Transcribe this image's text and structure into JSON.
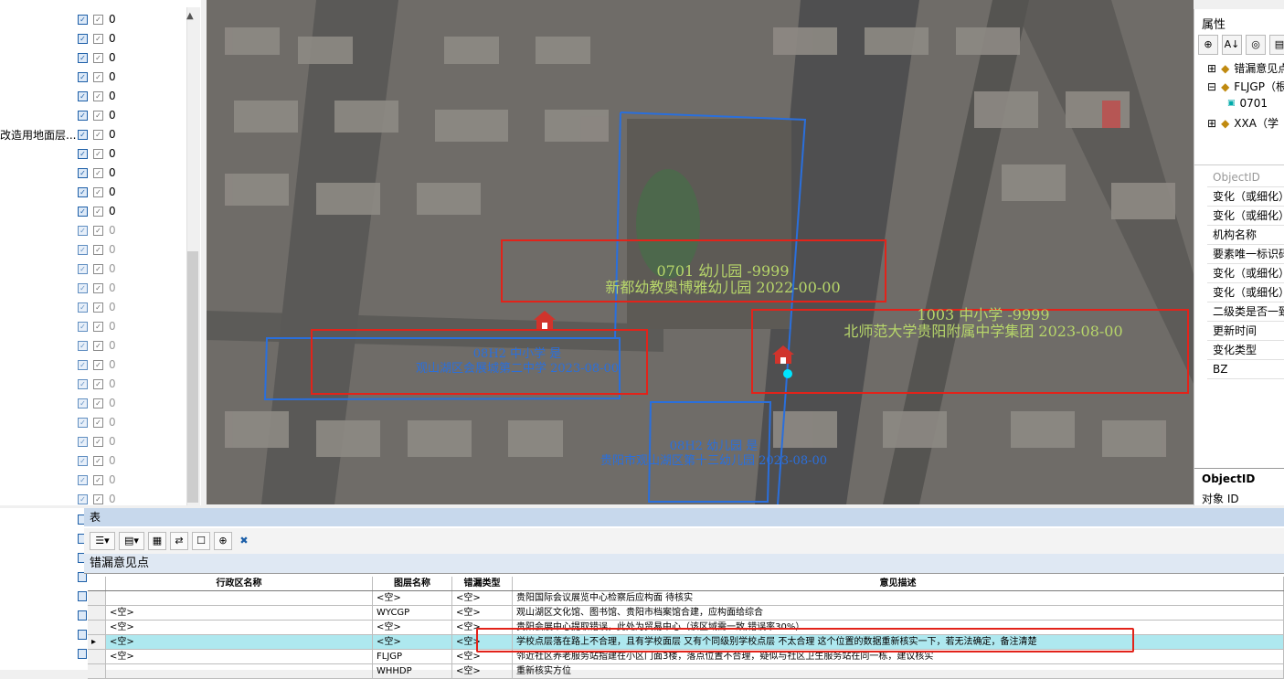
{
  "left": {
    "partial_layer_text": "改造用地面层...",
    "rows": [
      {
        "value": "0",
        "dim": false
      },
      {
        "value": "0",
        "dim": false
      },
      {
        "value": "0",
        "dim": false
      },
      {
        "value": "0",
        "dim": false
      },
      {
        "value": "0",
        "dim": false
      },
      {
        "value": "0",
        "dim": false
      },
      {
        "value": "0",
        "dim": false
      },
      {
        "value": "0",
        "dim": false
      },
      {
        "value": "0",
        "dim": false
      },
      {
        "value": "0",
        "dim": false
      },
      {
        "value": "0",
        "dim": false
      },
      {
        "value": "0",
        "dim": true
      },
      {
        "value": "0",
        "dim": true
      },
      {
        "value": "0",
        "dim": true
      },
      {
        "value": "0",
        "dim": true
      },
      {
        "value": "0",
        "dim": true
      },
      {
        "value": "0",
        "dim": true
      },
      {
        "value": "0",
        "dim": true
      },
      {
        "value": "0",
        "dim": true
      },
      {
        "value": "0",
        "dim": true
      },
      {
        "value": "0",
        "dim": true
      },
      {
        "value": "0",
        "dim": true
      },
      {
        "value": "0",
        "dim": true
      },
      {
        "value": "0",
        "dim": true
      },
      {
        "value": "0",
        "dim": true
      },
      {
        "value": "0",
        "dim": true
      },
      {
        "value": "0",
        "dim": true
      }
    ]
  },
  "map": {
    "labels": [
      {
        "line1": "0701 幼儿园 -9999",
        "line2": "新都幼教奥博雅幼儿园 2022-00-00",
        "color": "#b7d66a"
      },
      {
        "line1": "1003 中小学 -9999",
        "line2": "北师范大学贵阳附属中学集团 2023-08-00",
        "color": "#b7d66a"
      },
      {
        "line1": "08H2 中小学 是",
        "line2": "观山湖区会展城第二中学 2023-08-00",
        "color": "#2a6fdc"
      },
      {
        "line1": "08H2 幼儿园 是",
        "line2": "贵阳市观山湖区第十三幼儿园 2023-08-00",
        "color": "#2a6fdc"
      }
    ]
  },
  "properties": {
    "title": "属性",
    "toolbar": [
      "⊕",
      "A↓",
      "◎",
      "▤"
    ],
    "tree": [
      "错漏意见点",
      "FLJGP（根",
      "0701",
      "XXA（学"
    ],
    "fields": [
      "ObjectID",
      "变化（或细化）",
      "变化（或细化）",
      "机构名称",
      "要素唯一标识码",
      "变化（或细化）",
      "变化（或细化）",
      "二级类是否一致",
      "更新时间",
      "变化类型",
      "BZ"
    ],
    "desc_title": "ObjectID",
    "desc_text": "对象 ID"
  },
  "table": {
    "panel_title": "表",
    "tab_name": "错漏意见点",
    "columns": [
      "行政区名称",
      "图层名称",
      "错漏类型",
      "意见描述"
    ],
    "rows": [
      {
        "district": "",
        "layer": "<空>",
        "type": "<空>",
        "desc": "贵阳国际会议展览中心检察后应构面 待核实",
        "selected": false
      },
      {
        "district": "<空>",
        "layer": "WYCGP",
        "type": "<空>",
        "desc": "观山湖区文化馆、图书馆、贵阳市档案馆合建，应构面给综合",
        "selected": false
      },
      {
        "district": "<空>",
        "layer": "<空>",
        "type": "<空>",
        "desc": "贵阳会展中心提取错误，此处为贸易中心（该区域需一致,错误率30%）",
        "selected": false
      },
      {
        "district": "<空>",
        "layer": "<空>",
        "type": "<空>",
        "desc": "学校点层落在路上不合理，且有学校面层 又有个同级别学校点层 不太合理 这个位置的数据重新核实一下，若无法确定，备注清楚",
        "selected": true
      },
      {
        "district": "<空>",
        "layer": "FLJGP",
        "type": "<空>",
        "desc": "邻近社区养老服务站指建在小区门面3楼，落点位置不合理，疑似与社区卫生服务站在同一栋，建议核实",
        "selected": false
      },
      {
        "district": "",
        "layer": "WHHDP",
        "type": "<空>",
        "desc": "重新核实方位",
        "selected": false
      }
    ]
  }
}
